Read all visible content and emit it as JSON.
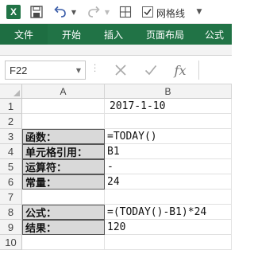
{
  "qat": {
    "logo_letter": "X",
    "gridlines_label": "网格线",
    "gridlines_checked": true
  },
  "tabs": [
    {
      "label": "文件"
    },
    {
      "label": "开始"
    },
    {
      "label": "插入"
    },
    {
      "label": "页面布局"
    },
    {
      "label": "公式"
    }
  ],
  "formula_bar": {
    "name_box": "F22",
    "fx_label": "fx",
    "formula": ""
  },
  "grid": {
    "columns": [
      "A",
      "B"
    ],
    "rows": [
      {
        "num": "1",
        "a": "",
        "b": "2017-1-10",
        "label": false
      },
      {
        "num": "2",
        "a": "",
        "b": "",
        "label": false
      },
      {
        "num": "3",
        "a": "函数：",
        "b": "=TODAY()",
        "label": true
      },
      {
        "num": "4",
        "a": "单元格引用：",
        "b": "B1",
        "label": true
      },
      {
        "num": "5",
        "a": "运算符：",
        "b": "-",
        "label": true
      },
      {
        "num": "6",
        "a": "常量：",
        "b": "24",
        "label": true
      },
      {
        "num": "7",
        "a": "",
        "b": "",
        "label": false
      },
      {
        "num": "8",
        "a": "公式：",
        "b": "=(TODAY()-B1)*24",
        "label": true
      },
      {
        "num": "9",
        "a": "结果：",
        "b": "120",
        "label": true
      },
      {
        "num": "10",
        "a": "",
        "b": "",
        "label": false
      }
    ]
  },
  "colors": {
    "accent": "#217346",
    "header_bg": "#f3f3f3",
    "label_fill": "#d9d9d9"
  }
}
